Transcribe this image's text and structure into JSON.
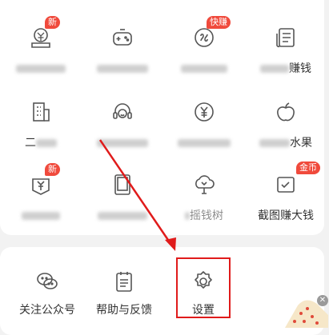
{
  "grid": [
    {
      "label_visible": "",
      "label_tail": "",
      "badge": "新",
      "icon": "voucher-icon"
    },
    {
      "label_visible": "",
      "label_tail": "",
      "badge": "",
      "icon": "gamepad-icon"
    },
    {
      "label_visible": "",
      "label_tail": "",
      "badge": "快赚",
      "icon": "coin-link-icon"
    },
    {
      "label_visible": "",
      "label_tail": "赚钱",
      "badge": "",
      "icon": "news-icon"
    },
    {
      "label_visible": "二",
      "label_tail": "",
      "badge": "",
      "icon": "building-icon"
    },
    {
      "label_visible": "",
      "label_tail": "",
      "badge": "",
      "icon": "headset-icon"
    },
    {
      "label_visible": "",
      "label_tail": "",
      "badge": "",
      "icon": "yuan-circle-icon"
    },
    {
      "label_visible": "",
      "label_tail": "水果",
      "badge": "",
      "icon": "fruit-icon"
    },
    {
      "label_visible": "",
      "label_tail": "",
      "badge": "新",
      "icon": "yuan-card-icon"
    },
    {
      "label_visible": "",
      "label_tail": "",
      "badge": "",
      "icon": "tablet-icon"
    },
    {
      "label_visible": "",
      "label_tail": "摇钱树",
      "badge": "",
      "icon": "cloud-icon"
    },
    {
      "label_visible": "截图赚大钱",
      "label_tail": "",
      "badge": "金币",
      "icon": "screenshot-icon"
    }
  ],
  "bottom": [
    {
      "label": "关注公众号",
      "icon": "wechat-icon"
    },
    {
      "label": "帮助与反馈",
      "icon": "clipboard-icon"
    },
    {
      "label": "设置",
      "icon": "settings-gear-icon"
    }
  ],
  "colors": {
    "badge": "#f04a3c",
    "annotation": "#e01b1b",
    "icon": "#555555"
  }
}
